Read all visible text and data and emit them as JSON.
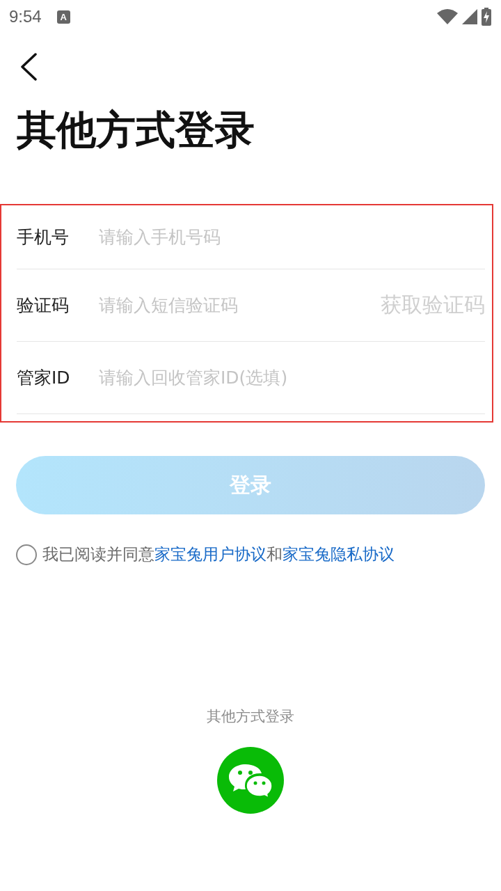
{
  "status_bar": {
    "time": "9:54",
    "notification": "A"
  },
  "header": {
    "title": "其他方式登录"
  },
  "form": {
    "highlighted": true,
    "fields": [
      {
        "label": "手机号",
        "placeholder": "请输入手机号码"
      },
      {
        "label": "验证码",
        "placeholder": "请输入短信验证码",
        "action": {
          "label": "获取验证码",
          "disabled": true
        }
      },
      {
        "label": "管家ID",
        "placeholder": "请输入回收管家ID(选填)"
      }
    ]
  },
  "login_button": {
    "label": "登录",
    "disabled": true
  },
  "agreement": {
    "checked": false,
    "parts": [
      {
        "kind": "text",
        "text": "我已阅读并同意"
      },
      {
        "kind": "link",
        "text": "家宝兔用户协议"
      },
      {
        "kind": "text",
        "text": "和"
      },
      {
        "kind": "link",
        "text": "家宝兔隐私协议"
      }
    ]
  },
  "other_login": {
    "title": "其他方式登录"
  }
}
